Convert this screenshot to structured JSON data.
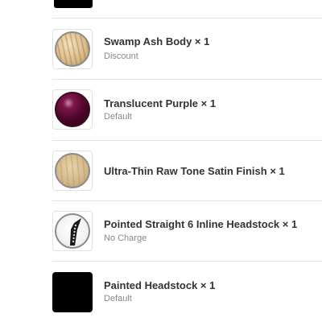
{
  "order_items": [
    {
      "title": "Swamp Ash Body × 1",
      "subtitle": "Discount",
      "thumbnail": "swamp-ash-wood-swatch"
    },
    {
      "title": "Translucent Purple × 1",
      "subtitle": "Default",
      "thumbnail": "translucent-purple-swatch"
    },
    {
      "title": "Ultra-Thin Raw Tone Satin Finish × 1",
      "subtitle": "",
      "thumbnail": "raw-tone-satin-swatch"
    },
    {
      "title": "Pointed Straight 6 Inline Headstock × 1",
      "subtitle": "No Charge",
      "thumbnail": "pointed-headstock-image"
    },
    {
      "title": "Painted Headstock × 1",
      "subtitle": "Default",
      "thumbnail": "black-painted-swatch"
    }
  ],
  "colors": {
    "purple": "#4c0628",
    "ash": "#dcbd8c",
    "raw_tone": "#d4b887",
    "painted": "#000000"
  }
}
